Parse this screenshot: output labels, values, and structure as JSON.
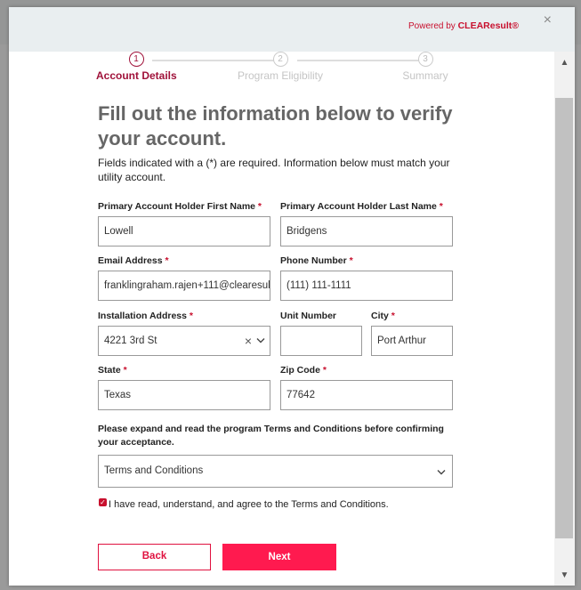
{
  "modal": {
    "powered_prefix": "Powered by ",
    "powered_brand": "CLEAResult®",
    "close_symbol": "×"
  },
  "stepper": {
    "steps": [
      {
        "number": "1",
        "label": "Account Details",
        "active": true
      },
      {
        "number": "2",
        "label": "Program Eligibility",
        "active": false
      },
      {
        "number": "3",
        "label": "Summary",
        "active": false
      }
    ]
  },
  "form": {
    "title": "Fill out the information below to verify your account.",
    "intro": "Fields indicated with a (*) are required. Information below must match your utility account.",
    "required_marker": "*",
    "fields": {
      "first_name": {
        "label": "Primary Account Holder First Name",
        "value": "Lowell"
      },
      "last_name": {
        "label": "Primary Account Holder Last Name",
        "value": "Bridgens"
      },
      "email": {
        "label": "Email Address",
        "value": "franklingraham.rajen+111@clearesul"
      },
      "phone": {
        "label": "Phone Number",
        "value": "(111) 111-1111"
      },
      "address": {
        "label": "Installation Address",
        "value": "4221 3rd St"
      },
      "unit": {
        "label": "Unit Number",
        "value": ""
      },
      "city": {
        "label": "City",
        "value": "Port Arthur"
      },
      "state": {
        "label": "State",
        "value": "Texas"
      },
      "zip": {
        "label": "Zip Code",
        "value": "77642"
      }
    },
    "terms_note": "Please expand and read the program Terms and Conditions before confirming your acceptance.",
    "terms_select": "Terms and Conditions",
    "agree_label": "I have read, understand, and agree to the Terms and Conditions.",
    "agree_checked": true
  },
  "buttons": {
    "back": "Back",
    "next": "Next"
  },
  "colors": {
    "accent": "#c8102e",
    "step_active": "#a0123a",
    "primary_button": "#ff1a4f"
  }
}
